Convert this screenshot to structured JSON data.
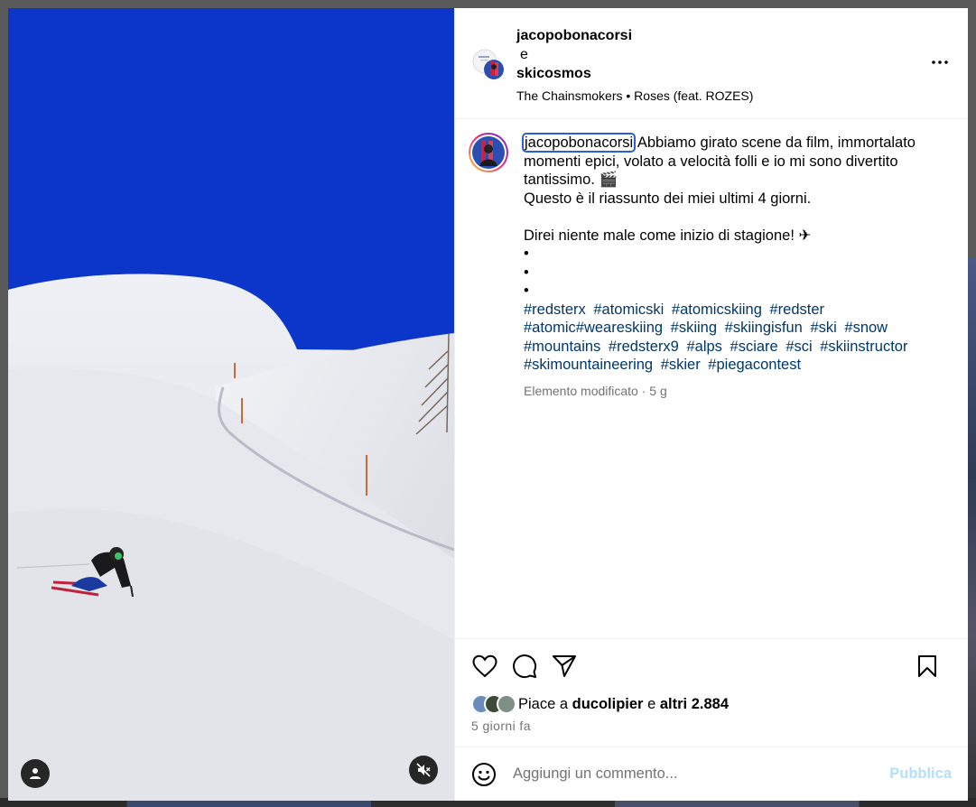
{
  "header": {
    "author1": "jacopobonacorsi",
    "conjunction": "e",
    "author2": "skicosmos",
    "audio": "The Chainsmokers • Roses (feat. ROZES)",
    "more_icon": "more-horizontal-icon"
  },
  "caption": {
    "author": "jacopobonacorsi",
    "text": " Abbiamo girato scene da film, immortalato momenti epici, volato a velocità folli e io mi sono divertito tantissimo. 🎬\nQuesto è il riassunto dei miei ultimi 4 giorni.\n\nDirei niente male come inizio di stagione! ✈\n•\n•\n•",
    "hashtags": [
      "#redsterx",
      "#atomicski",
      "#atomicskiing",
      "#redster",
      "#atomic#weareskiing",
      "#skiing",
      "#skiingisfun",
      "#ski",
      "#snow",
      "#mountains",
      "#redsterx9",
      "#alps",
      "#sciare",
      "#sci",
      "#skiinstructor",
      "#skimountaineering",
      "#skier",
      "#piegacontest"
    ],
    "meta": "Elemento modificato · 5 g"
  },
  "likes": {
    "prefix": "Piace a",
    "user": "ducolipier",
    "middle": "e",
    "others": "altri 2.884",
    "ago": "5 giorni fa"
  },
  "comment": {
    "placeholder": "Aggiungi un commento...",
    "publish": "Pubblica"
  },
  "colors": {
    "sky": "#0b36c9",
    "hashtag": "#00376b",
    "publish_disabled": "#b2dffc",
    "meta_gray": "#737373"
  }
}
